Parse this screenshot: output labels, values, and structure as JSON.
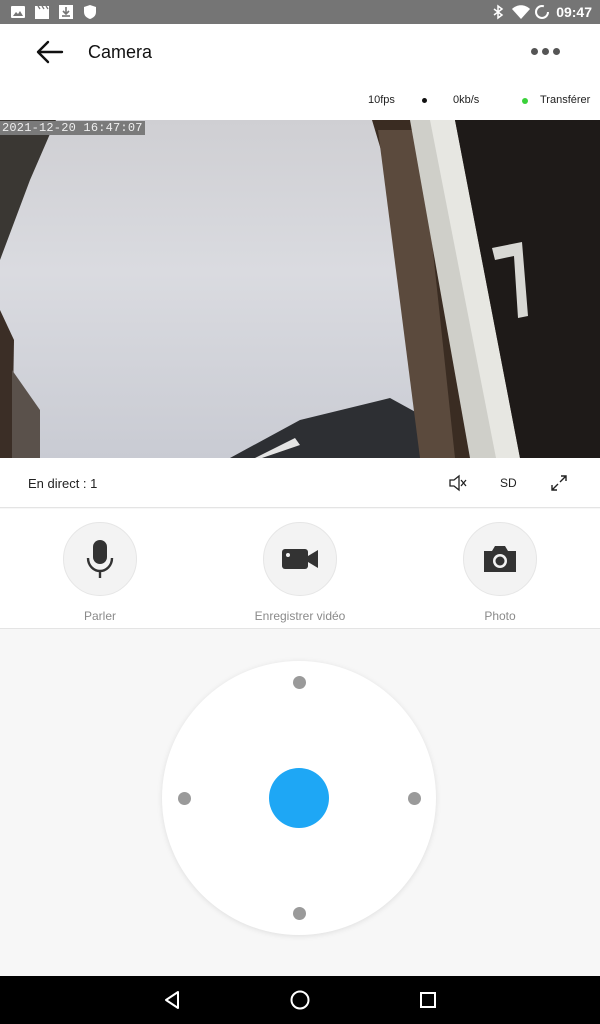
{
  "status_bar": {
    "time": "09:47",
    "left_icons": [
      "image-icon",
      "clapper-icon",
      "download-icon",
      "shield-icon"
    ],
    "right_icons": [
      "bluetooth-icon",
      "wifi-icon",
      "battery-ring-icon"
    ]
  },
  "app_bar": {
    "title": "Camera",
    "back_icon": "arrow-left-icon",
    "more_icon": "more-horizontal-icon"
  },
  "stats": {
    "fps": "10fps",
    "bitrate": "0kb/s",
    "transfer": "Transférer",
    "transfer_color": "#3ad13a"
  },
  "video": {
    "timestamp": "2021-12-20 16:47:07"
  },
  "controls": {
    "live": "En direct : 1",
    "quality": "SD",
    "mute_icon": "speaker-mute-icon",
    "fullscreen_icon": "expand-icon"
  },
  "actions": [
    {
      "label": "Parler",
      "icon": "microphone-icon"
    },
    {
      "label": "Enregistrer vidéo",
      "icon": "video-camera-icon"
    },
    {
      "label": "Photo",
      "icon": "camera-icon"
    }
  ],
  "ptz": {
    "center_color": "#1ea7f5"
  },
  "nav_bar": {
    "icons": [
      "back-triangle-icon",
      "home-circle-icon",
      "recents-square-icon"
    ]
  }
}
